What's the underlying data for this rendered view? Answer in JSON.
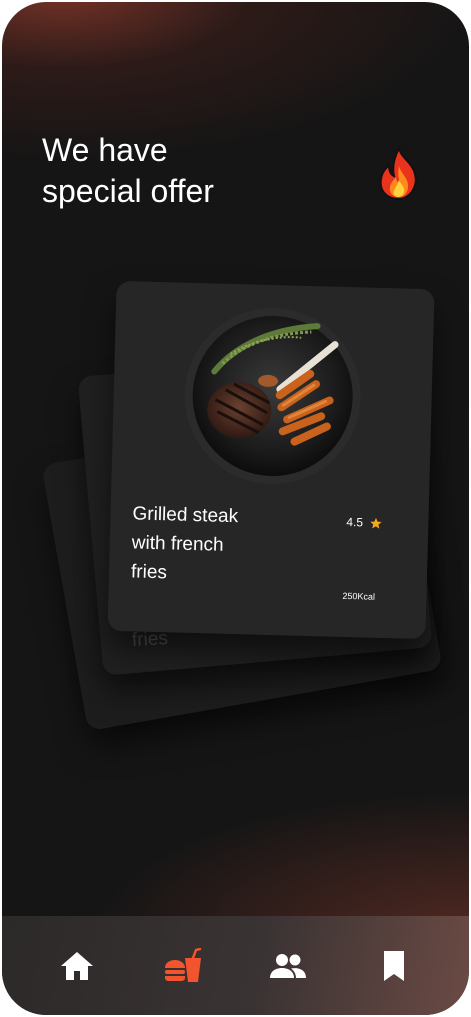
{
  "headline": {
    "line1": "We have",
    "line2": "special offer"
  },
  "header_icon": "fire-icon",
  "offer_card": {
    "title_lines": [
      "Grilled steak",
      "with french",
      "fries"
    ],
    "rating": "4.5",
    "rating_icon": "star-icon",
    "calories": "250Kcal",
    "image": "grilled-steak-plate"
  },
  "stacked_card_peek_text": "fries",
  "bottom_nav": {
    "items": [
      {
        "icon": "home-icon",
        "active": false
      },
      {
        "icon": "fast-food-icon",
        "active": true
      },
      {
        "icon": "people-icon",
        "active": false
      },
      {
        "icon": "bookmark-icon",
        "active": false
      }
    ]
  },
  "colors": {
    "background": "#151515",
    "card": "#262626",
    "accent": "#f2542d",
    "star": "#f5a623",
    "text": "#ffffff"
  }
}
